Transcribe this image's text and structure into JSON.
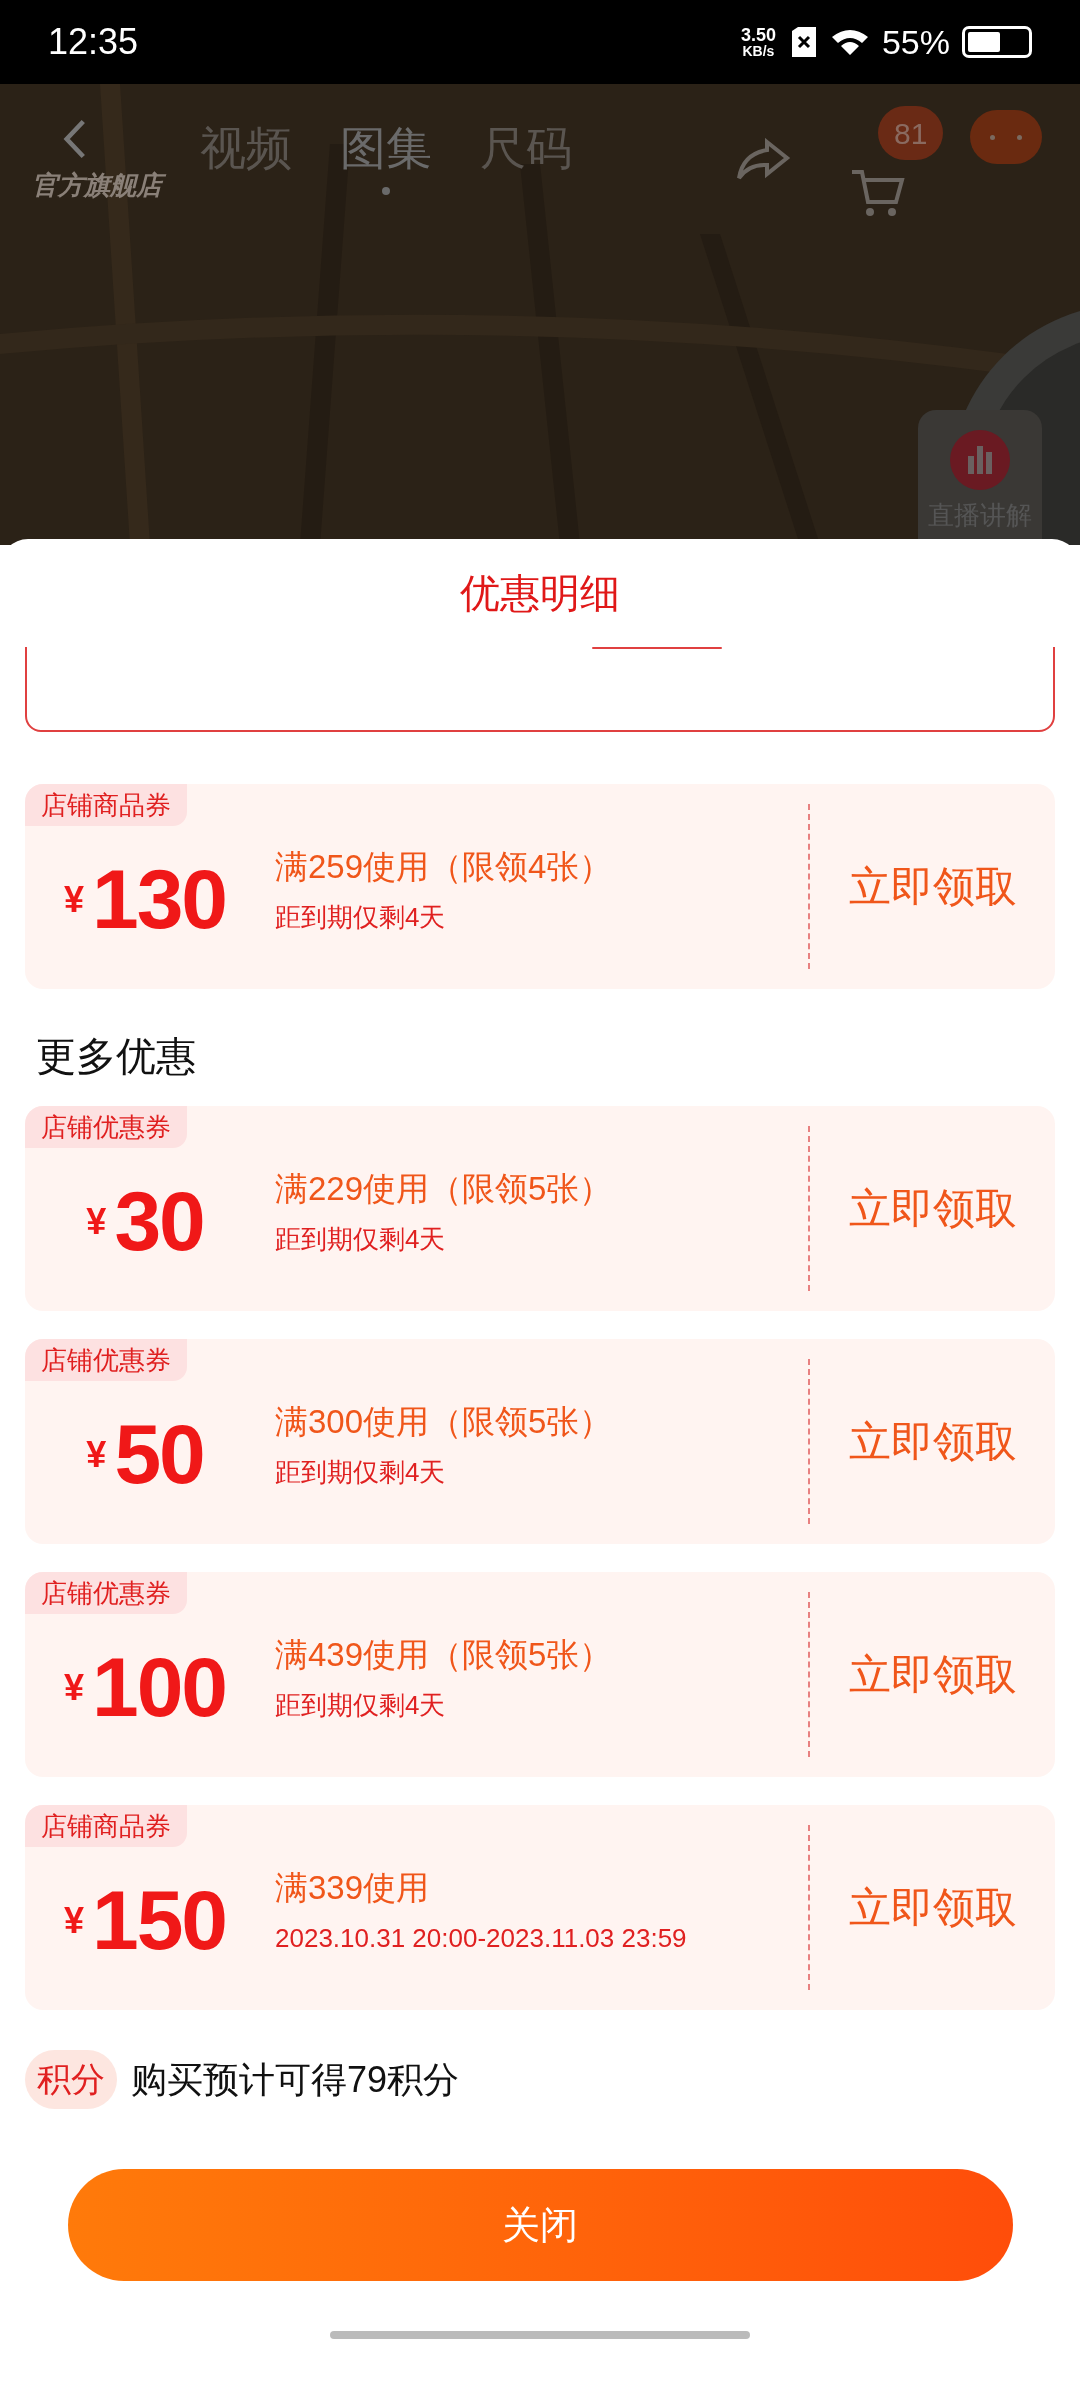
{
  "status_bar": {
    "time": "12:35",
    "net_speed": "3.50",
    "net_unit": "KB/s",
    "battery": "55%"
  },
  "background_page": {
    "store_logo": "官方旗舰店",
    "tabs": [
      {
        "label": "视频",
        "selected": false
      },
      {
        "label": "图集",
        "selected": true
      },
      {
        "label": "尺码",
        "selected": false
      }
    ],
    "cart_badge": "81",
    "live_button": "直播讲解"
  },
  "sheet": {
    "title": "优惠明细",
    "coupons": [
      {
        "tag": "店铺商品券",
        "currency": "¥",
        "amount": "130",
        "condition": "满259使用（限领4张）",
        "validity": "距到期仅剩4天",
        "action": "立即领取"
      }
    ],
    "more_title": "更多优惠",
    "more_coupons": [
      {
        "tag": "店铺优惠券",
        "currency": "¥",
        "amount": "30",
        "condition": "满229使用（限领5张）",
        "validity": "距到期仅剩4天",
        "action": "立即领取"
      },
      {
        "tag": "店铺优惠券",
        "currency": "¥",
        "amount": "50",
        "condition": "满300使用（限领5张）",
        "validity": "距到期仅剩4天",
        "action": "立即领取"
      },
      {
        "tag": "店铺优惠券",
        "currency": "¥",
        "amount": "100",
        "condition": "满439使用（限领5张）",
        "validity": "距到期仅剩4天",
        "action": "立即领取"
      },
      {
        "tag": "店铺商品券",
        "currency": "¥",
        "amount": "150",
        "condition": "满339使用",
        "validity": "2023.10.31 20:00-2023.11.03 23:59",
        "action": "立即领取"
      }
    ],
    "points": {
      "tag": "积分",
      "text": "购买预计可得79积分"
    },
    "close_button": "关闭"
  }
}
